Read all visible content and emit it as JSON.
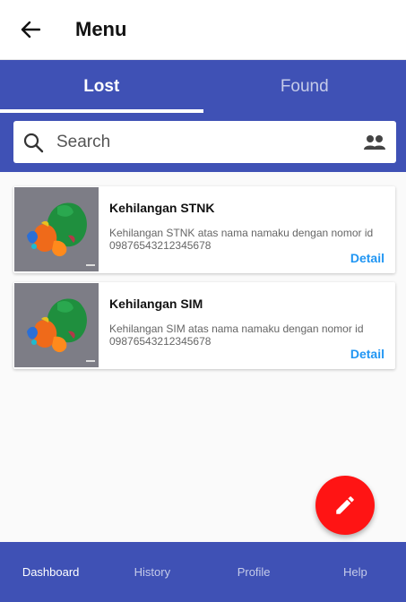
{
  "app_bar": {
    "title": "Menu",
    "back_icon": "arrow-back-icon"
  },
  "tabs": [
    {
      "label": "Lost",
      "active": true
    },
    {
      "label": "Found",
      "active": false
    }
  ],
  "search": {
    "placeholder": "Search",
    "value": "",
    "left_icon": "search-icon",
    "right_icon": "people-icon"
  },
  "items": [
    {
      "title": "Kehilangan STNK",
      "description": "Kehilangan STNK atas nama namaku dengan nomor id 09876543212345678",
      "action": "Detail",
      "thumbnail": "map-thumbnail"
    },
    {
      "title": "Kehilangan SIM",
      "description": "Kehilangan SIM atas nama namaku dengan nomor id 09876543212345678",
      "action": "Detail",
      "thumbnail": "map-thumbnail"
    }
  ],
  "fab": {
    "icon": "pencil-icon",
    "color": "#ff1414"
  },
  "bottom_nav": [
    {
      "label": "Dashboard",
      "active": true
    },
    {
      "label": "History",
      "active": false
    },
    {
      "label": "Profile",
      "active": false
    },
    {
      "label": "Help",
      "active": false
    }
  ],
  "colors": {
    "primary": "#3f51b5",
    "accent_link": "#2196f3",
    "fab": "#ff1414"
  }
}
